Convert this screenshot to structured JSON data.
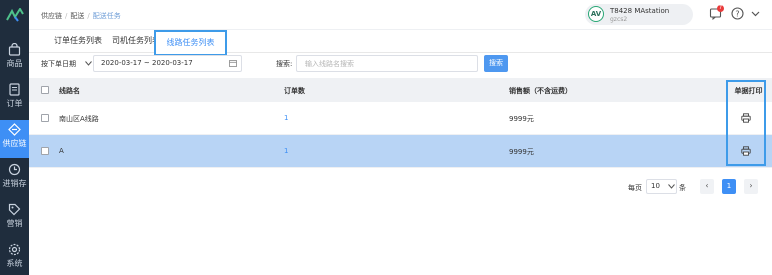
{
  "sidebar": {
    "items": [
      {
        "label": "商品",
        "icon": "bag-icon"
      },
      {
        "label": "订单",
        "icon": "order-icon"
      },
      {
        "label": "供应链",
        "icon": "supply-chain-icon",
        "active": true
      },
      {
        "label": "进销存",
        "icon": "inventory-icon"
      },
      {
        "label": "营销",
        "icon": "tag-icon"
      },
      {
        "label": "系统",
        "icon": "gear-icon"
      }
    ]
  },
  "header": {
    "breadcrumb": [
      "供应链",
      "配送",
      "配送任务"
    ],
    "user_name": "T8428 MAstation",
    "user_sub": "gzcs2",
    "avatar_text": "AV",
    "notification_count": "7"
  },
  "tabs": [
    "订单任务列表",
    "司机任务列表",
    "线路任务列表"
  ],
  "filter": {
    "date_type": "按下单日期",
    "date_range": "2020-03-17 ~ 2020-03-17",
    "search_label": "搜索:",
    "search_placeholder": "输入线路名搜索",
    "search_button": "搜索"
  },
  "table": {
    "columns": [
      "线路名",
      "订单数",
      "销售额（不含运费）",
      "单据打印"
    ],
    "rows": [
      {
        "name": "南山区A线路",
        "count": "1",
        "amount": "9999元"
      },
      {
        "name": "A",
        "count": "1",
        "amount": "9999元"
      }
    ]
  },
  "pagination": {
    "per_page_label": "每页",
    "page_size": "10",
    "unit": "条",
    "prev": "‹",
    "current": "1",
    "next": "›"
  },
  "colors": {
    "sidebar_bg": "#1f2d3d",
    "accent": "#3e8ff5",
    "selected_row": "#b8d4f5",
    "highlight_box": "#3e9be9"
  }
}
